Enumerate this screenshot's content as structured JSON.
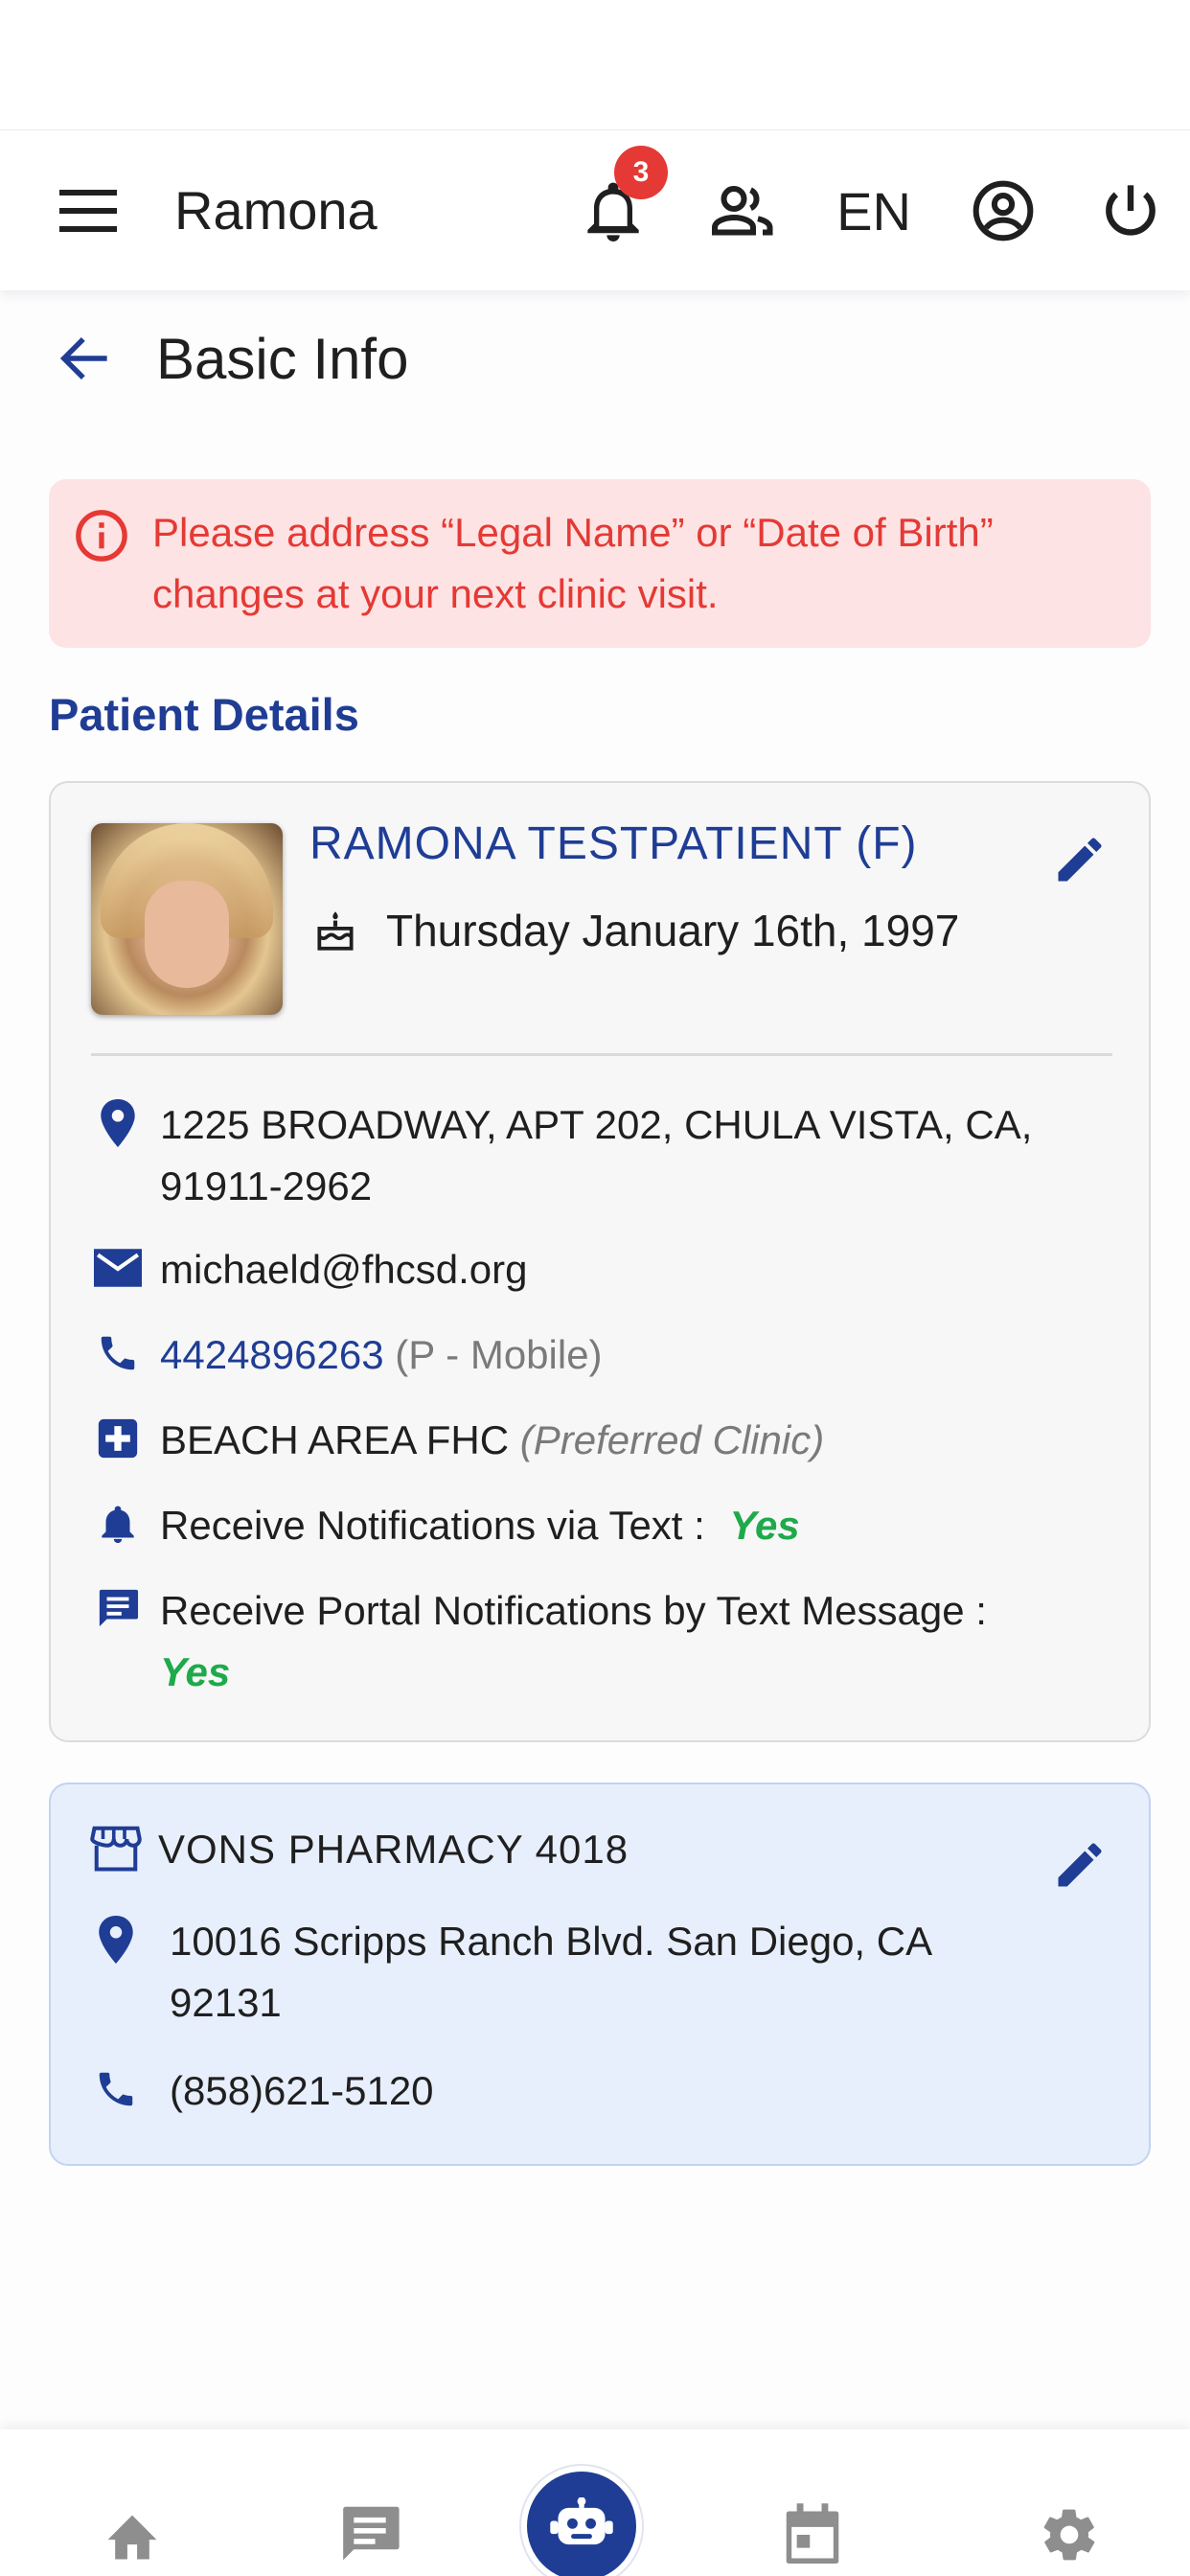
{
  "header": {
    "user_name": "Ramona",
    "notification_count": "3",
    "language": "EN"
  },
  "page": {
    "title": "Basic Info"
  },
  "alert": {
    "message": "Please address “Legal Name” or “Date of Birth” changes at your next clinic visit."
  },
  "patient_details": {
    "section_title": "Patient Details",
    "name": "RAMONA TESTPATIENT (F)",
    "dob": "Thursday January 16th, 1997",
    "address": "1225 BROADWAY, APT 202, CHULA VISTA, CA, 91911-2962",
    "email": "michaeld@fhcsd.org",
    "phone": "4424896263",
    "phone_type": "(P - Mobile)",
    "clinic": "BEACH AREA FHC",
    "clinic_note": "(Preferred Clinic)",
    "text_notifications_label": "Receive Notifications via Text :",
    "text_notifications_value": "Yes",
    "portal_notifications_label": "Receive Portal Notifications by Text Message :",
    "portal_notifications_value": "Yes"
  },
  "pharmacy": {
    "name": "VONS PHARMACY 4018",
    "address": "10016 Scripps Ranch Blvd. San Diego, CA 92131",
    "phone": "(858)621-5120"
  },
  "colors": {
    "primary": "#1f3d94",
    "alert_bg": "#fde3e3",
    "alert_text": "#e53935",
    "success": "#1eaa4a",
    "pharmacy_bg": "#e8effc"
  },
  "icons": {
    "top_bar": [
      "menu-icon",
      "bell-icon",
      "people-icon",
      "account-circle-icon",
      "power-icon"
    ],
    "bottom_nav": [
      "home-icon",
      "chat-icon",
      "robot-icon",
      "calendar-icon",
      "settings-icon"
    ]
  }
}
